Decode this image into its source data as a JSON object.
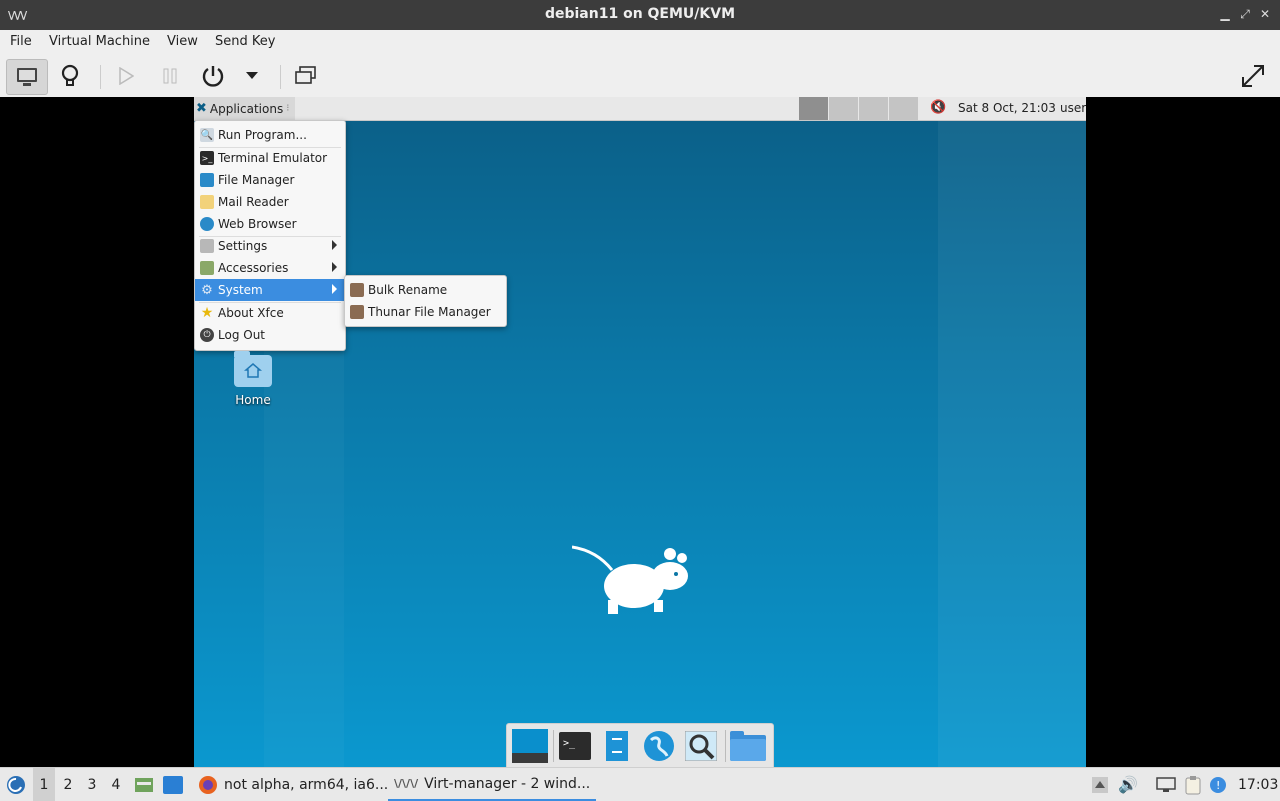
{
  "window": {
    "title": "debian11 on QEMU/KVM",
    "app_icon_text": "\\/\\/\\/",
    "controls": [
      "minimize-icon",
      "maximize-icon",
      "close-icon"
    ]
  },
  "menubar": [
    "File",
    "Virtual Machine",
    "View",
    "Send Key"
  ],
  "toolbar": {
    "buttons": [
      "console-icon",
      "details-lightbulb-icon",
      "run-icon",
      "pause-icon",
      "power-icon",
      "dropdown-arrow-icon",
      "snapshots-icon",
      "fullscreen-icon"
    ],
    "active": "console-icon"
  },
  "guest": {
    "panel": {
      "applications_label": "Applications",
      "workspaces": 4,
      "current_workspace": 1,
      "datetime": "Sat  8 Oct, 21:03",
      "user": "user"
    },
    "app_menu": {
      "items": [
        {
          "label": "Run Program...",
          "icon": "search-icon"
        },
        {
          "label": "Terminal Emulator",
          "icon": "terminal-icon"
        },
        {
          "label": "File Manager",
          "icon": "file-cabinet-icon"
        },
        {
          "label": "Mail Reader",
          "icon": "mail-icon"
        },
        {
          "label": "Web Browser",
          "icon": "globe-icon"
        },
        {
          "label": "Settings",
          "icon": "settings-icon",
          "submenu": true
        },
        {
          "label": "Accessories",
          "icon": "accessories-icon",
          "submenu": true
        },
        {
          "label": "System",
          "icon": "system-gear-icon",
          "submenu": true,
          "selected": true
        },
        {
          "label": "About Xfce",
          "icon": "star-icon"
        },
        {
          "label": "Log Out",
          "icon": "logout-icon"
        }
      ]
    },
    "system_submenu": [
      {
        "label": "Bulk Rename",
        "icon": "hammer-icon"
      },
      {
        "label": "Thunar File Manager",
        "icon": "hammer-icon"
      }
    ],
    "desktop_icons": [
      {
        "label": "Home",
        "icon": "home-folder-icon"
      }
    ],
    "dock": [
      "show-desktop-icon",
      "terminal-icon",
      "file-manager-icon",
      "web-browser-icon",
      "app-finder-icon",
      "folder-icon"
    ]
  },
  "taskbar": {
    "workspaces": [
      "1",
      "2",
      "3",
      "4"
    ],
    "current_workspace": "1",
    "tasks": [
      {
        "label": "not alpha, arm64, ia6...",
        "icon": "firefox-icon"
      },
      {
        "label": "Virt-manager - 2 wind...",
        "icon": "virt-manager-icon",
        "active": true
      }
    ],
    "clock": "17:03"
  }
}
